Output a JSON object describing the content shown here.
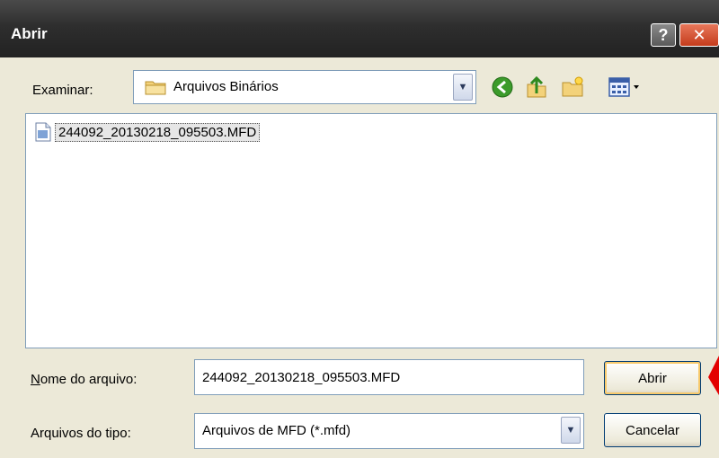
{
  "window": {
    "title": "Abrir",
    "help_glyph": "?",
    "close_glyph": "✕"
  },
  "toolbar": {
    "look_in_label": "Examinar:",
    "look_in_value": "Arquivos Binários",
    "icons": [
      "back-icon",
      "up-folder-icon",
      "new-folder-icon",
      "views-menu-icon"
    ]
  },
  "file_list": {
    "items": [
      {
        "name": "244092_20130218_095503.MFD",
        "icon": "mfd-file-icon",
        "selected": true
      }
    ]
  },
  "bottom": {
    "filename_label": "Nome do arquivo:",
    "filename_value": "244092_20130218_095503.MFD",
    "filetype_label": "Arquivos do tipo:",
    "filetype_value": "Arquivos de MFD (*.mfd)",
    "open_button": "Abrir",
    "cancel_button": "Cancelar"
  },
  "colors": {
    "titlebar": "#2e2e2e",
    "dialog_bg": "#ece9d8",
    "annotation_arrow": "#e30000"
  }
}
